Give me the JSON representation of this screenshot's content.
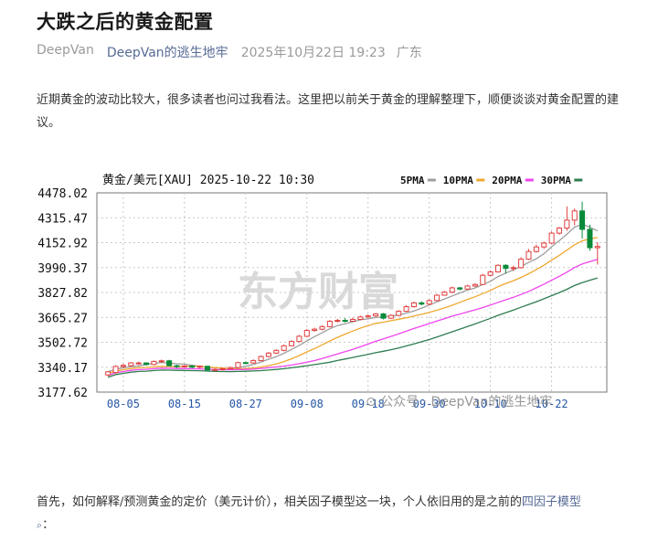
{
  "article": {
    "title": "大跌之后的黄金配置",
    "meta": {
      "author": "DeepVan",
      "account": "DeepVan的逃生地牢",
      "time": "2025年10月22日 19:23",
      "location": "广东"
    },
    "intro": "近期黄金的波动比较大，很多读者也问过我看法。这里把以前关于黄金的理解整理下，顺便谈谈对黄金配置的建议。",
    "para2_text": "首先，如何解释/预测黄金的定价（美元计价），相关因子模型这一块，个人依旧用的是之前的",
    "para2_link": "四因子模型",
    "para2_end": "："
  },
  "chart_image": {
    "header_title": "黄金/美元[XAU] 2025-10-22 10:30",
    "watermark_text": "东方财富",
    "caption_watermark": "公众号 · DeepVan的逃生地牢"
  },
  "chart_data": {
    "type": "candlestick",
    "title": "黄金/美元[XAU] 2025-10-22 10:30",
    "legend": [
      {
        "name": "5PMA",
        "color": "#9e9e9e"
      },
      {
        "name": "10PMA",
        "color": "#f0a830"
      },
      {
        "name": "20PMA",
        "color": "#ee44ee"
      },
      {
        "name": "30PMA",
        "color": "#2e7d4f"
      }
    ],
    "yticks": [
      "4478.02",
      "4315.47",
      "4152.92",
      "3990.37",
      "3827.82",
      "3665.27",
      "3502.72",
      "3340.17",
      "3177.62"
    ],
    "ylim": [
      3177.62,
      4478.02
    ],
    "xticks": [
      {
        "label": "08-05",
        "index": 2
      },
      {
        "label": "08-15",
        "index": 10
      },
      {
        "label": "08-27",
        "index": 18
      },
      {
        "label": "09-08",
        "index": 26
      },
      {
        "label": "09-18",
        "index": 34
      },
      {
        "label": "09-30",
        "index": 42
      },
      {
        "label": "10-10",
        "index": 50
      },
      {
        "label": "10-22",
        "index": 58
      }
    ],
    "up_color": "#e04040",
    "down_color": "#0a8a3a",
    "candles": [
      [
        3290,
        3310,
        3280,
        3315
      ],
      [
        3305,
        3345,
        3298,
        3352
      ],
      [
        3345,
        3352,
        3334,
        3362
      ],
      [
        3350,
        3368,
        3342,
        3374
      ],
      [
        3366,
        3368,
        3356,
        3376
      ],
      [
        3368,
        3358,
        3350,
        3372
      ],
      [
        3358,
        3378,
        3352,
        3384
      ],
      [
        3378,
        3382,
        3368,
        3390
      ],
      [
        3382,
        3350,
        3344,
        3388
      ],
      [
        3350,
        3344,
        3336,
        3356
      ],
      [
        3344,
        3348,
        3338,
        3356
      ],
      [
        3348,
        3340,
        3334,
        3354
      ],
      [
        3340,
        3346,
        3332,
        3352
      ],
      [
        3346,
        3322,
        3316,
        3350
      ],
      [
        3322,
        3325,
        3314,
        3332
      ],
      [
        3325,
        3330,
        3318,
        3338
      ],
      [
        3330,
        3338,
        3324,
        3344
      ],
      [
        3338,
        3370,
        3334,
        3376
      ],
      [
        3370,
        3368,
        3360,
        3378
      ],
      [
        3368,
        3383,
        3364,
        3392
      ],
      [
        3383,
        3410,
        3380,
        3416
      ],
      [
        3410,
        3432,
        3404,
        3440
      ],
      [
        3432,
        3450,
        3426,
        3458
      ],
      [
        3450,
        3480,
        3444,
        3488
      ],
      [
        3480,
        3508,
        3476,
        3516
      ],
      [
        3508,
        3542,
        3502,
        3550
      ],
      [
        3542,
        3580,
        3536,
        3590
      ],
      [
        3580,
        3588,
        3572,
        3598
      ],
      [
        3588,
        3605,
        3580,
        3614
      ],
      [
        3605,
        3640,
        3600,
        3648
      ],
      [
        3640,
        3646,
        3632,
        3655
      ],
      [
        3646,
        3640,
        3632,
        3660
      ],
      [
        3640,
        3652,
        3636,
        3664
      ],
      [
        3652,
        3668,
        3646,
        3676
      ],
      [
        3668,
        3675,
        3662,
        3684
      ],
      [
        3675,
        3688,
        3668,
        3694
      ],
      [
        3688,
        3660,
        3652,
        3694
      ],
      [
        3660,
        3678,
        3654,
        3686
      ],
      [
        3678,
        3705,
        3674,
        3712
      ],
      [
        3705,
        3735,
        3700,
        3744
      ],
      [
        3735,
        3760,
        3728,
        3768
      ],
      [
        3760,
        3752,
        3744,
        3770
      ],
      [
        3752,
        3775,
        3746,
        3782
      ],
      [
        3775,
        3810,
        3770,
        3818
      ],
      [
        3810,
        3830,
        3806,
        3838
      ],
      [
        3830,
        3858,
        3822,
        3866
      ],
      [
        3858,
        3850,
        3842,
        3864
      ],
      [
        3850,
        3870,
        3846,
        3878
      ],
      [
        3870,
        3880,
        3864,
        3888
      ],
      [
        3880,
        3940,
        3876,
        3950
      ],
      [
        3940,
        3962,
        3934,
        3972
      ],
      [
        3962,
        4005,
        3958,
        4012
      ],
      [
        4005,
        3985,
        3950,
        4012
      ],
      [
        3985,
        3990,
        3968,
        4002
      ],
      [
        3990,
        4045,
        3984,
        4058
      ],
      [
        4045,
        4095,
        4040,
        4112
      ],
      [
        4095,
        4125,
        4088,
        4140
      ],
      [
        4125,
        4150,
        4112,
        4160
      ],
      [
        4150,
        4215,
        4144,
        4226
      ],
      [
        4215,
        4248,
        4205,
        4256
      ],
      [
        4248,
        4300,
        4230,
        4390
      ],
      [
        4300,
        4360,
        4266,
        4376
      ],
      [
        4360,
        4240,
        4180,
        4420
      ],
      [
        4240,
        4120,
        4100,
        4270
      ],
      [
        4120,
        4128,
        4010,
        4156
      ]
    ]
  }
}
